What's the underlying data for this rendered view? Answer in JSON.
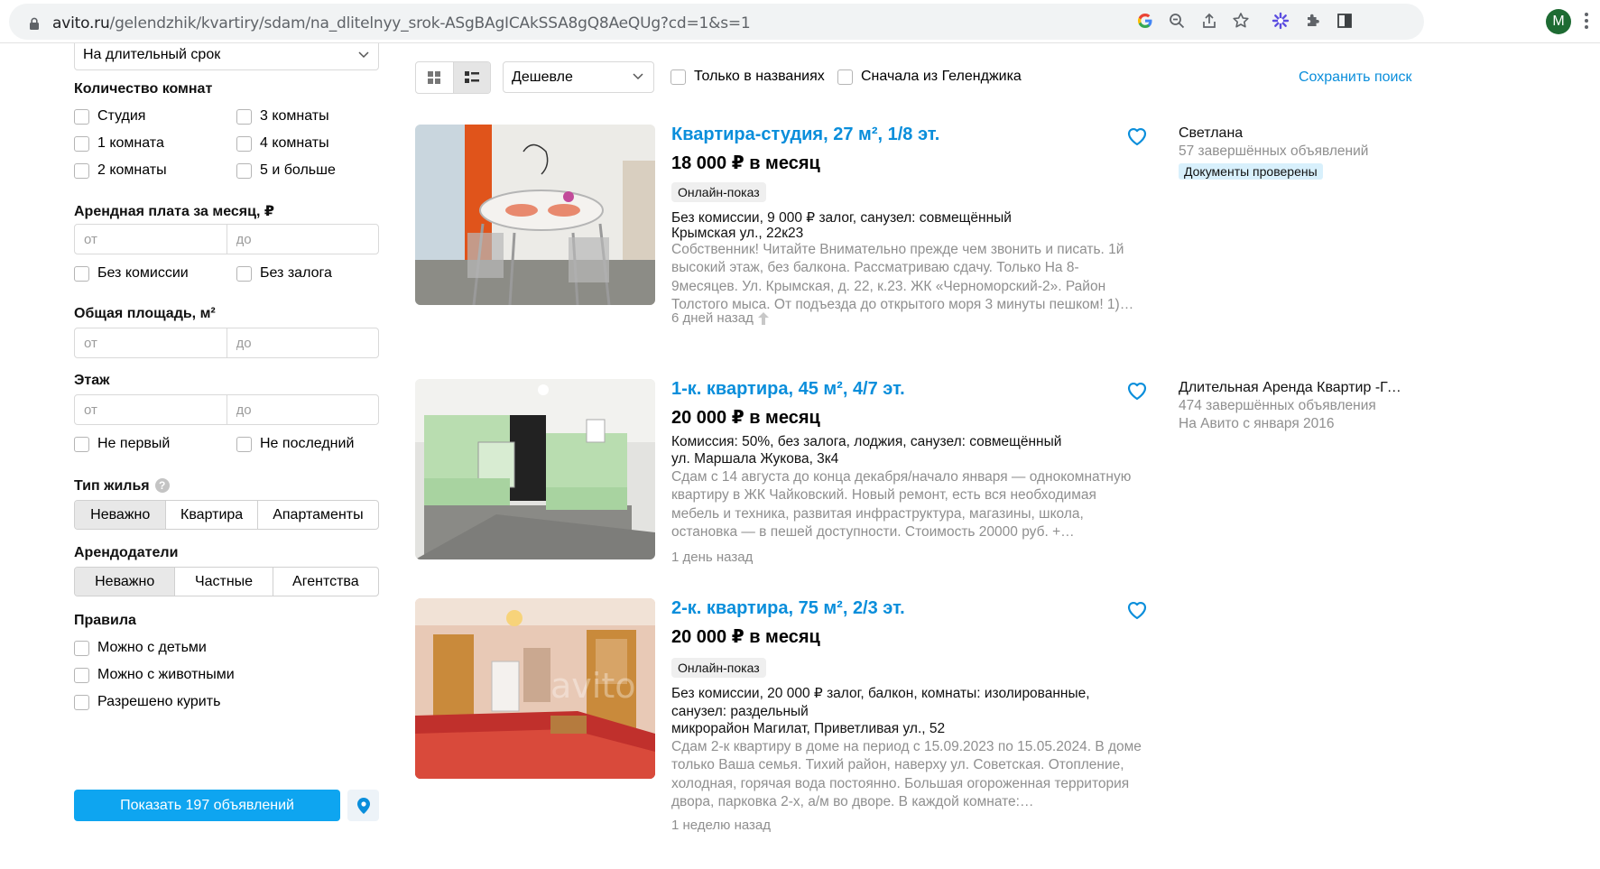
{
  "browser": {
    "url_host": "avito.ru",
    "url_path": "/gelendzhik/kvartiry/sdam/na_dlitelnyy_srok-ASgBAgICAkSSA8gQ8AeQUg?cd=1&s=1",
    "profile_initial": "M",
    "accent_color": "#1e6b33"
  },
  "sidebar": {
    "rent_term": "На длительный срок",
    "rooms_label": "Количество комнат",
    "rooms": [
      "Студия",
      "3 комнаты",
      "1 комната",
      "4 комнаты",
      "2 комнаты",
      "5 и больше"
    ],
    "price_label": "Арендная плата за месяц, ₽",
    "price_from": "от",
    "price_to": "до",
    "no_commission": "Без комиссии",
    "no_deposit": "Без залога",
    "area_label": "Общая площадь, м²",
    "area_from": "от",
    "area_to": "до",
    "floor_label": "Этаж",
    "floor_from": "от",
    "floor_to": "до",
    "not_first": "Не первый",
    "not_last": "Не последний",
    "housing_label": "Тип жилья",
    "housing_help": "?",
    "housing_options": [
      "Неважно",
      "Квартира",
      "Апартаменты"
    ],
    "landlords_label": "Арендодатели",
    "landlord_options": [
      "Неважно",
      "Частные",
      "Агентства"
    ],
    "rules_label": "Правила",
    "rules": [
      "Можно с детьми",
      "Можно с животными",
      "Разрешено курить"
    ],
    "show_button": "Показать 197 объявлений",
    "button_color": "#0ea5f0"
  },
  "toolbar": {
    "sort": "Дешевле",
    "only_titles": "Только в названиях",
    "first_from": "Сначала из Геленджика",
    "save_search": "Сохранить поиск",
    "link_color": "#0a8edb"
  },
  "listings": [
    {
      "title": "Квартира-студия, 27 м², 1/8 эт.",
      "price": "18 000 ₽ в месяц",
      "badge": "Онлайн-показ",
      "params": "Без комиссии, 9 000 ₽ залог, санузел: совмещённый",
      "address": "Крымская ул., 22к23",
      "description": "Собственник! Читайте Внимательно прежде чем звонить и писать. 1й высокий этаж, без балкона. Рассматриваю сдачу. Только На 8-9месяцев. Ул. Крымская, д. 22, к.23. ЖК «Черноморский-2». Район Толстого мыса. От подъезда до открытого моря 3 минуты пешком! 1)…",
      "date": "6 дней назад",
      "seller_name": "Светлана",
      "seller_stats": "57 завершённых объявлений",
      "seller_badge": "Документы проверены"
    },
    {
      "title": "1-к. квартира, 45 м², 4/7 эт.",
      "price": "20 000 ₽ в месяц",
      "params": "Комиссия: 50%, без залога, лоджия, санузел: совмещённый",
      "address": "ул. Маршала Жукова, 3к4",
      "description": "Сдам с 14 августа до конца декабря/начало января — однокомнатную квартиру в ЖК Чайковский. Новый ремонт, есть вся необходимая мебель и техника, развитая инфраструктура, магазины, школа, остановка — в пешей доступности. Стоимость 20000 руб. +…",
      "date": "1 день назад",
      "seller_name": "Длительная Аренда Квартир -Ге…",
      "seller_stats": "474 завершённых объявления",
      "seller_since": "На Авито с января 2016"
    },
    {
      "title": "2-к. квартира, 75 м², 2/3 эт.",
      "price": "20 000 ₽ в месяц",
      "badge": "Онлайн-показ",
      "params": "Без комиссии, 20 000 ₽ залог, балкон, комнаты: изолированные, санузел: раздельный",
      "address": "микрорайон Магилат, Приветливая ул., 52",
      "description": "Сдам 2-к квартиру в доме на период с 15.09.2023 по 15.05.2024. В доме только Ваша семья. Тихий район, наверху ул. Советская. Отопление, холодная, горячая вода постоянно. Большая огороженная территория двора, парковка 2-х, а/м во дворе. В каждой комнате:…",
      "date": "1 неделю назад",
      "watermark": "avito"
    }
  ]
}
